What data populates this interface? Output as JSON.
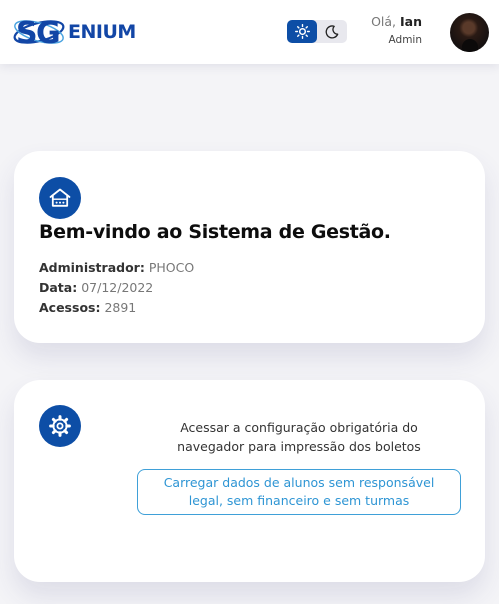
{
  "brand": {
    "logo_text": "ENIUM",
    "logo_mark": "SG"
  },
  "header": {
    "greeting_prefix": "Olá,",
    "user_name": "Ian",
    "role": "Admin",
    "theme_icons": [
      "sun-icon",
      "moon-icon"
    ],
    "theme_active": "light"
  },
  "welcome_card": {
    "icon": "school-icon",
    "title": "Bem-vindo ao Sistema de Gestão.",
    "admin_label": "Administrador:",
    "admin_value": "PHOCO",
    "date_label": "Data:",
    "date_value": "07/12/2022",
    "access_label": "Acessos:",
    "access_value": "2891"
  },
  "config_card": {
    "icon": "gear-icon",
    "config_text": "Acessar a configuração obrigatória do navegador para impressão dos boletos",
    "load_button_label": "Carregar dados de alunos sem responsável legal, sem financeiro e sem turmas"
  },
  "colors": {
    "primary": "#0d4ea6",
    "accent": "#2e95d4",
    "background": "#f4f4f7"
  }
}
